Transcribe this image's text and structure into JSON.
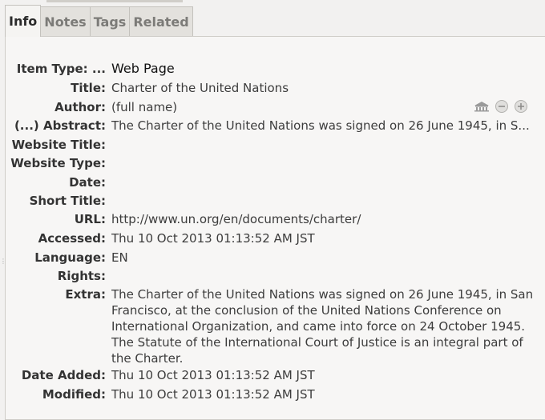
{
  "tabs": [
    {
      "label": "Info",
      "active": true
    },
    {
      "label": "Notes"
    },
    {
      "label": "Tags"
    },
    {
      "label": "Related"
    }
  ],
  "fields": {
    "item_type": {
      "label": "Item Type: ...",
      "value": "Web Page"
    },
    "title": {
      "label": "Title:",
      "value": "Charter of the United Nations"
    },
    "author": {
      "label": "Author:",
      "value": "(full name)"
    },
    "abstract": {
      "label": "(...) Abstract:",
      "value": "The Charter of the United Nations was signed on 26 June 1945, in S..."
    },
    "website_title": {
      "label": "Website Title:",
      "value": ""
    },
    "website_type": {
      "label": "Website Type:",
      "value": ""
    },
    "date": {
      "label": "Date:",
      "value": ""
    },
    "short_title": {
      "label": "Short Title:",
      "value": ""
    },
    "url": {
      "label": "URL:",
      "value": "http://www.un.org/en/documents/charter/"
    },
    "accessed": {
      "label": "Accessed:",
      "value": "Thu 10 Oct 2013 01:13:52 AM JST"
    },
    "language": {
      "label": "Language:",
      "value": "EN"
    },
    "rights": {
      "label": "Rights:",
      "value": ""
    },
    "extra": {
      "label": "Extra:",
      "value": "The Charter of the United Nations was signed on 26 June 1945, in San Francisco, at the conclusion of the United Nations Conference on International Organization, and came into force on 24 October 1945. The Statute of the International Court of Justice is an integral part of the Charter."
    },
    "date_added": {
      "label": "Date Added:",
      "value": "Thu 10 Oct 2013 01:13:52 AM JST"
    },
    "modified": {
      "label": "Modified:",
      "value": "Thu 10 Oct 2013 01:13:52 AM JST"
    }
  },
  "icons": [
    "institution-icon",
    "minus-circle-icon",
    "plus-circle-icon"
  ]
}
